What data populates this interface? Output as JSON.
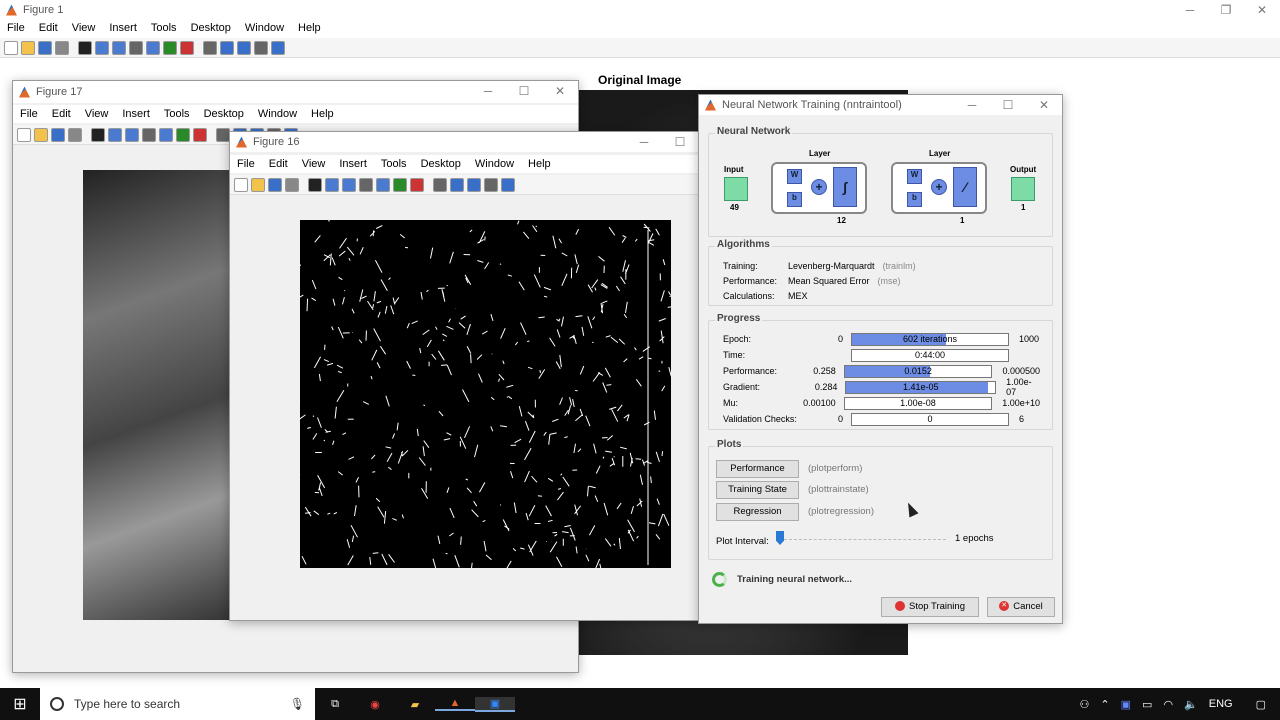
{
  "fig1": {
    "title": "Figure 1",
    "menu": [
      "File",
      "Edit",
      "View",
      "Insert",
      "Tools",
      "Desktop",
      "Window",
      "Help"
    ],
    "image_title": "Original Image"
  },
  "fig17": {
    "title": "Figure 17",
    "menu": [
      "File",
      "Edit",
      "View",
      "Insert",
      "Tools",
      "Desktop",
      "Window",
      "Help"
    ]
  },
  "fig16": {
    "title": "Figure 16",
    "menu": [
      "File",
      "Edit",
      "View",
      "Insert",
      "Tools",
      "Desktop",
      "Window",
      "Help"
    ]
  },
  "nn": {
    "title": "Neural Network Training (nntraintool)",
    "network": {
      "heading": "Neural Network",
      "input_label": "Input",
      "input_size": "49",
      "layer1_label": "Layer",
      "layer1_size": "12",
      "layer2_label": "Layer",
      "layer2_size": "1",
      "output_label": "Output",
      "output_size": "1",
      "w": "W",
      "b": "b"
    },
    "algorithms": {
      "heading": "Algorithms",
      "rows": [
        {
          "label": "Training:",
          "value": "Levenberg-Marquardt",
          "fn": "(trainlm)"
        },
        {
          "label": "Performance:",
          "value": "Mean Squared Error",
          "fn": "(mse)"
        },
        {
          "label": "Calculations:",
          "value": "MEX",
          "fn": ""
        }
      ]
    },
    "progress": {
      "heading": "Progress",
      "rows": [
        {
          "label": "Epoch:",
          "min": "0",
          "value": "602 iterations",
          "max": "1000",
          "fill": 60.2
        },
        {
          "label": "Time:",
          "min": "",
          "value": "0:44:00",
          "max": "",
          "fill": 0
        },
        {
          "label": "Performance:",
          "min": "0.258",
          "value": "0.0152",
          "max": "0.000500",
          "fill": 58
        },
        {
          "label": "Gradient:",
          "min": "0.284",
          "value": "1.41e-05",
          "max": "1.00e-07",
          "fill": 95
        },
        {
          "label": "Mu:",
          "min": "0.00100",
          "value": "1.00e-08",
          "max": "1.00e+10",
          "fill": 0
        },
        {
          "label": "Validation Checks:",
          "min": "0",
          "value": "0",
          "max": "6",
          "fill": 0
        }
      ]
    },
    "plots": {
      "heading": "Plots",
      "buttons": [
        {
          "label": "Performance",
          "fn": "(plotperform)"
        },
        {
          "label": "Training State",
          "fn": "(plottrainstate)"
        },
        {
          "label": "Regression",
          "fn": "(plotregression)"
        }
      ],
      "interval_label": "Plot Interval:",
      "interval_value": "1 epochs"
    },
    "status": "Training neural network...",
    "stop_label": "Stop Training",
    "cancel_label": "Cancel"
  },
  "taskbar": {
    "search_placeholder": "Type here to search",
    "lang": "ENG"
  }
}
